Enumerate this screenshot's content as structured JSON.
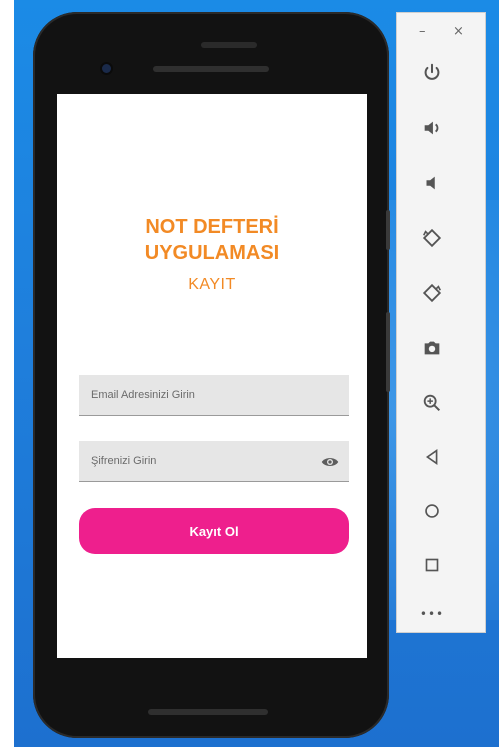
{
  "app": {
    "title_line1": "NOT DEFTERİ",
    "title_line2": "UYGULAMASI",
    "subtitle": "KAYIT"
  },
  "form": {
    "email_placeholder": "Email Adresinizi Girin",
    "password_placeholder": "Şifrenizi Girin",
    "signup_label": "Kayıt Ol"
  },
  "emulator_toolbar": {
    "minimize": "–",
    "close": "×",
    "more": "•••",
    "icons": [
      "power-icon",
      "volume-up-icon",
      "volume-down-icon",
      "rotate-left-icon",
      "rotate-right-icon",
      "camera-icon",
      "zoom-icon",
      "back-icon",
      "home-icon",
      "overview-icon",
      "more-icon"
    ]
  },
  "colors": {
    "accent_orange": "#f28a25",
    "button_pink": "#ee1f8d",
    "desktop_blue": "#1f7fdc"
  }
}
